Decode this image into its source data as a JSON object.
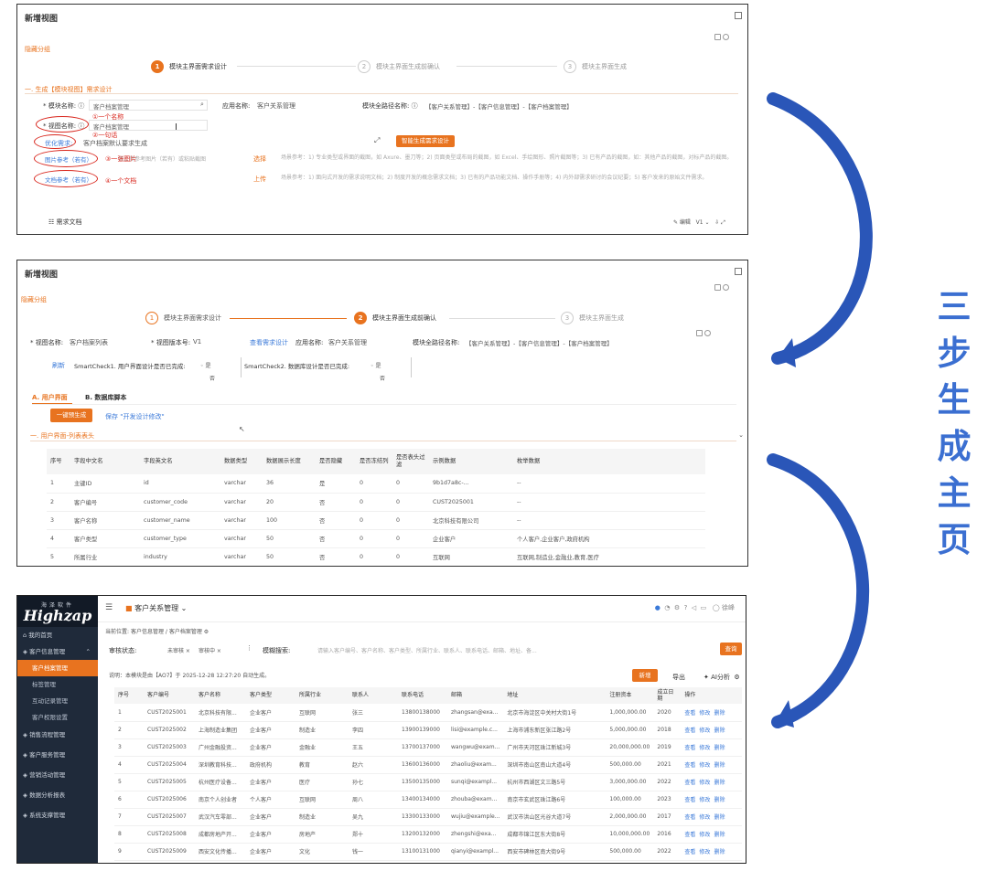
{
  "side_text": [
    "三",
    "步",
    "生",
    "成",
    "主",
    "页"
  ],
  "panel1": {
    "title": "新增视图",
    "hide_group": "隐藏分组",
    "steps": [
      {
        "num": "1",
        "label": "模块主界面需求设计"
      },
      {
        "num": "2",
        "label": "模块主界面生成前确认"
      },
      {
        "num": "3",
        "label": "模块主界面生成"
      }
    ],
    "section": "一. 生成【模块视图】需求设计",
    "module_name_label": "模块名称:",
    "module_name_value": "客户档案管理",
    "app_name_label": "应用名称:",
    "app_name_value": "客户关系管理",
    "full_path_label": "模块全路径名称:",
    "full_path_value": "【客户关系管理】-【客户信息管理】-【客户档案管理】",
    "view_name_label": "视图名称:",
    "view_name_value": "客户档案管理",
    "optimize_label": "优化需求:",
    "optimize_value": "客户档案默认要求生成",
    "image_ref_label": "图片参考（若有）",
    "image_ref_hint": "请上传参考图片（若有）或粘贴截图",
    "doc_ref_label": "文档参考（若有）",
    "select_label": "选择",
    "select_hint": "场景参考：1) 专业类型或界面的截图，如 Axure、墨刀等；2) 页面类型或布局的截图，如 Excel、手绘图形、照片截图等；3) 已有产品的截图，如：其他产品的截图，对标产品的截图。",
    "upload_label": "上传",
    "upload_hint": "场景参考：1) 面向式开发的需求说明文档；2) 制度开发的概念需求文档；3) 已有的产品功能文档、操作手册等；4) 内外部需求研讨的会议纪要；5) 客户发来的原始文件需求。",
    "gen_button": "智能生成需求设计",
    "req_doc": "需求文档",
    "edit_label": "编辑",
    "version": "V1",
    "annotations": [
      "①一个名称",
      "②一句话",
      "③一张图片",
      "④一个文档"
    ]
  },
  "panel2": {
    "title": "新增视图",
    "hide_group": "隐藏分组",
    "steps": [
      {
        "num": "1",
        "label": "模块主界面需求设计"
      },
      {
        "num": "2",
        "label": "模块主界面生成前确认"
      },
      {
        "num": "3",
        "label": "模块主界面生成"
      }
    ],
    "view_name_label": "视图名称:",
    "view_name_value": "客户档案列表",
    "version_label": "视图版本号:",
    "version_value": "V1",
    "view_req_link": "查看需求设计",
    "app_name_label": "应用名称:",
    "app_name_value": "客户关系管理",
    "full_path_label": "模块全路径名称:",
    "full_path_value": "【客户关系管理】-【客户信息管理】-【客户档案管理】",
    "refresh": "刷新",
    "check1": "SmartCheck1. 用户界面设计是否已完成:",
    "check2": "SmartCheck2. 数据库设计是否已完成:",
    "yes": "是",
    "no": "否",
    "tab_a": "A. 用户界面",
    "tab_b": "B. 数据库脚本",
    "gen_button": "一键预生成",
    "save_link": "保存 \"开发设计修改\"",
    "section": "一. 用户界面-列表表头",
    "columns": [
      "序号",
      "字段中文名",
      "字段英文名",
      "数据类型",
      "数据展示长度",
      "是否隐藏",
      "是否冻结列",
      "是否表头过滤",
      "示例数据",
      "枚举数据"
    ],
    "rows": [
      [
        "1",
        "主键ID",
        "id",
        "varchar",
        "36",
        "是",
        "0",
        "0",
        "9b1d7a8c-...",
        "--"
      ],
      [
        "2",
        "客户编号",
        "customer_code",
        "varchar",
        "20",
        "否",
        "0",
        "0",
        "CUST2025001",
        "--"
      ],
      [
        "3",
        "客户名称",
        "customer_name",
        "varchar",
        "100",
        "否",
        "0",
        "0",
        "北京科技有限公司",
        "--"
      ],
      [
        "4",
        "客户类型",
        "customer_type",
        "varchar",
        "50",
        "否",
        "0",
        "0",
        "企业客户",
        "个人客户,企业客户,政府机构"
      ],
      [
        "5",
        "所属行业",
        "industry",
        "varchar",
        "50",
        "否",
        "0",
        "0",
        "互联网",
        "互联网,制造业,金融业,教育,医疗"
      ]
    ]
  },
  "panel3": {
    "logo_top": "海泽软件",
    "logo_main": "Highzap",
    "app_title": "客户关系管理",
    "user": "徐峰",
    "menu": [
      {
        "label": "我的首页",
        "type": "main"
      },
      {
        "label": "客户信息管理",
        "type": "main"
      },
      {
        "label": "客户档案管理",
        "type": "active"
      },
      {
        "label": "标签管理",
        "type": "sub"
      },
      {
        "label": "互动记录管理",
        "type": "sub"
      },
      {
        "label": "客户权限设置",
        "type": "sub"
      },
      {
        "label": "销售流程管理",
        "type": "main"
      },
      {
        "label": "客户服务管理",
        "type": "main"
      },
      {
        "label": "营销活动管理",
        "type": "main"
      },
      {
        "label": "数据分析报表",
        "type": "main"
      },
      {
        "label": "系统支撑管理",
        "type": "main"
      }
    ],
    "breadcrumb_label": "当前位置:",
    "breadcrumb": [
      "客户信息管理",
      "客户档案管理"
    ],
    "audit_label": "审核状态:",
    "audit_opt1": "未审核",
    "audit_opt2": "审核中",
    "search_label": "模糊搜索:",
    "search_placeholder": "请输入客户编号、客户名称、客户类型、所属行业、联系人、联系电话、邮箱、地址、备...",
    "query_button": "查询",
    "note": "说明：本模块是由【AO7】于 2025-12-28 12:27:20 自动生成。",
    "add_button": "新增",
    "export_button": "导出",
    "ai_button": "AI分析",
    "columns": [
      "序号",
      "客户编号",
      "客户名称",
      "客户类型",
      "所属行业",
      "联系人",
      "联系电话",
      "邮箱",
      "地址",
      "注册资本",
      "成立日期",
      "操作"
    ],
    "actions": [
      "查看",
      "修改",
      "删除"
    ],
    "rows": [
      [
        "1",
        "CUST2025001",
        "北京科技有限...",
        "企业客户",
        "互联网",
        "张三",
        "13800138000",
        "zhangsan@exa...",
        "北京市海淀区中关村大街1号",
        "1,000,000.00",
        "2020"
      ],
      [
        "2",
        "CUST2025002",
        "上海制造业集团",
        "企业客户",
        "制造业",
        "李四",
        "13900139000",
        "lisi@example.c...",
        "上海市浦东新区张江路2号",
        "5,000,000.00",
        "2018"
      ],
      [
        "3",
        "CUST2025003",
        "广州金融投资...",
        "企业客户",
        "金融业",
        "王五",
        "13700137000",
        "wangwu@exam...",
        "广州市天河区珠江新城3号",
        "20,000,000.00",
        "2019"
      ],
      [
        "4",
        "CUST2025004",
        "深圳教育科技...",
        "政府机构",
        "教育",
        "赵六",
        "13600136000",
        "zhaoliu@exam...",
        "深圳市南山区南山大道4号",
        "500,000.00",
        "2021"
      ],
      [
        "5",
        "CUST2025005",
        "杭州医疗设备...",
        "企业客户",
        "医疗",
        "孙七",
        "13500135000",
        "sunqi@exampl...",
        "杭州市西湖区文三路5号",
        "3,000,000.00",
        "2022"
      ],
      [
        "6",
        "CUST2025006",
        "南京个人创业者",
        "个人客户",
        "互联网",
        "周八",
        "13400134000",
        "zhouba@exam...",
        "南京市玄武区珠江路6号",
        "100,000.00",
        "2023"
      ],
      [
        "7",
        "CUST2025007",
        "武汉汽车零部...",
        "企业客户",
        "制造业",
        "吴九",
        "13300133000",
        "wujiu@example...",
        "武汉市洪山区光谷大道7号",
        "2,000,000.00",
        "2017"
      ],
      [
        "8",
        "CUST2025008",
        "成都房地产开...",
        "企业客户",
        "房地产",
        "郑十",
        "13200132000",
        "zhengshi@exa...",
        "成都市锦江区东大街8号",
        "10,000,000.00",
        "2016"
      ],
      [
        "9",
        "CUST2025009",
        "西安文化传播...",
        "企业客户",
        "文化",
        "钱一",
        "13100131000",
        "qianyi@exampl...",
        "西安市碑林区南大街9号",
        "500,000.00",
        "2022"
      ],
      [
        "10",
        "CUST2025010",
        "长沙物流运输...",
        "企业客户",
        "物流",
        "孙二",
        "13000130000",
        "sunert@exampl...",
        "长沙市雨花区韶山南路10号",
        "1,500,000.00",
        "2020"
      ]
    ]
  }
}
